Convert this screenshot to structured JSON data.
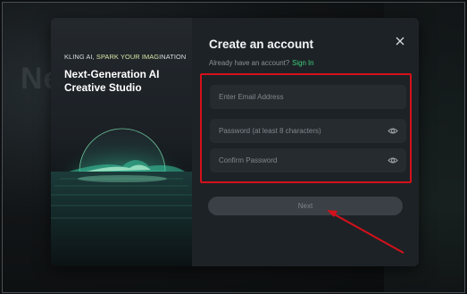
{
  "background": {
    "decor_text": "Ne"
  },
  "modal": {
    "left_panel": {
      "tagline_brand": "KLING AI, ",
      "tagline_accent": "SPARK YOUR IMAG",
      "tagline_rest": "INATION",
      "headline": "Next-Generation AI Creative Studio"
    },
    "title": "Create an account",
    "subtitle": "Already have an account?",
    "signin_label": "Sign In",
    "close_icon": "close-icon",
    "fields": {
      "email_placeholder": "Enter Email Address",
      "password_placeholder": "Password (at least 8 characters)",
      "confirm_placeholder": "Confirm Password",
      "eye_icon": "eye-icon"
    },
    "next_label": "Next"
  },
  "annotation": {
    "highlight_color": "#d4111b",
    "arrow_color": "#d4111b"
  },
  "colors": {
    "accent_green": "#3ed07d",
    "panel_bg": "#1d2226",
    "field_bg": "#262b30"
  }
}
